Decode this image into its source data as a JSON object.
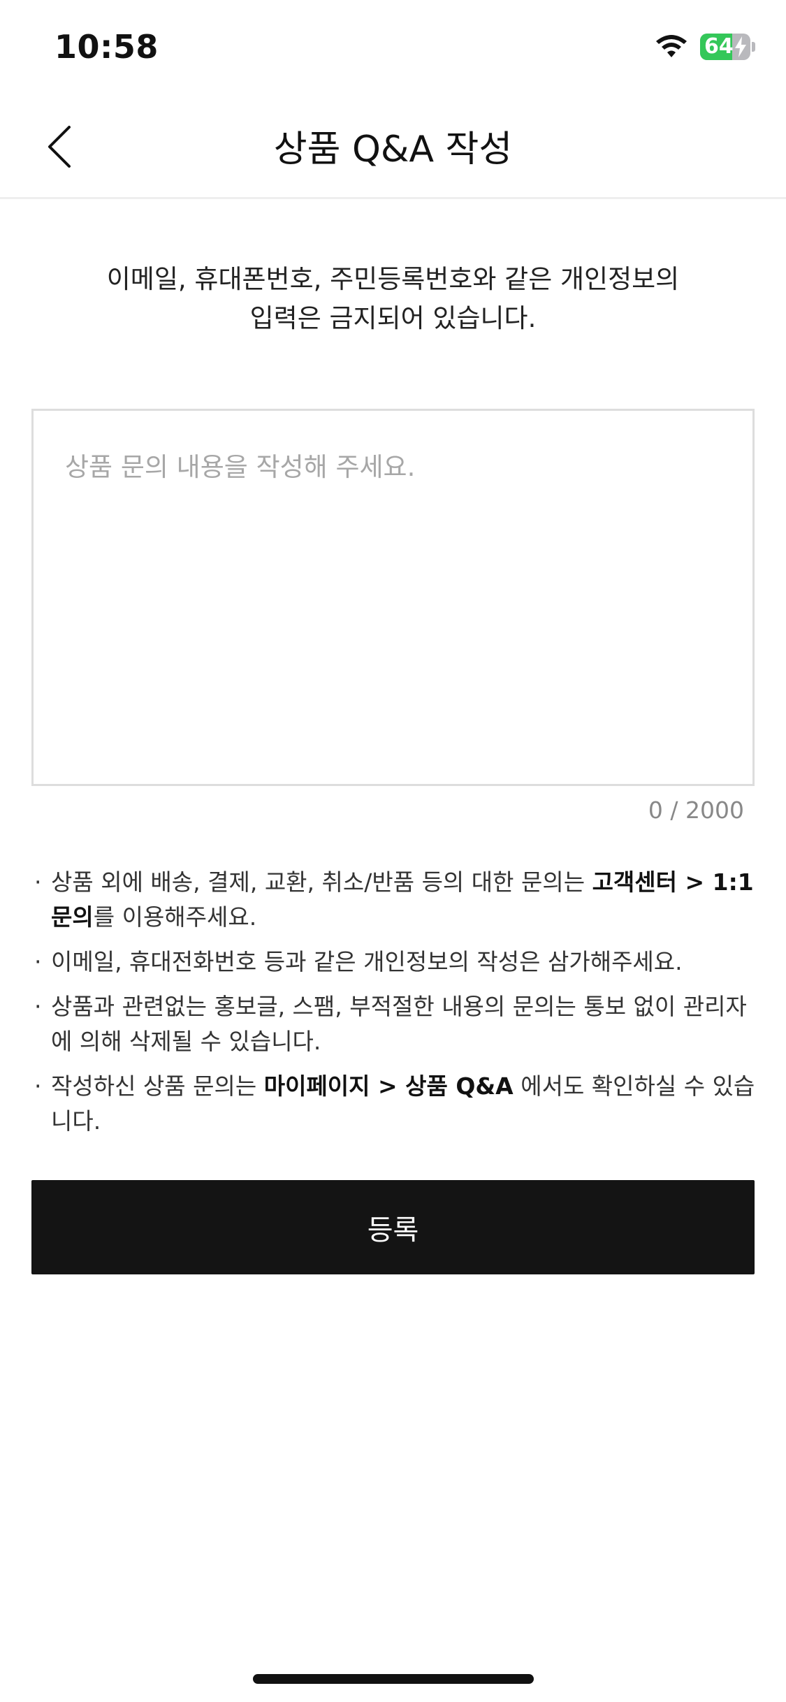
{
  "status_bar": {
    "time": "10:58",
    "battery_level": "64",
    "battery_percent": 64,
    "battery_color": "#34c759"
  },
  "header": {
    "title": "상품 Q&A 작성",
    "back_icon": "chevron-left-icon"
  },
  "notice": {
    "line1": "이메일, 휴대폰번호, 주민등록번호와 같은 개인정보의",
    "line2": "입력은 금지되어 있습니다."
  },
  "form": {
    "input_value": "",
    "input_placeholder": "상품 문의 내용을 작성해 주세요.",
    "char_count": "0 / 2000"
  },
  "guidelines": [
    {
      "before": "상품 외에 배송, 결제, 교환, 취소/반품 등의 대한 문의는 ",
      "bold": "고객센터 > 1:1문의",
      "after": "를 이용해주세요."
    },
    {
      "before": "이메일, 휴대전화번호 등과 같은 개인정보의 작성은 삼가해주세요.",
      "bold": "",
      "after": ""
    },
    {
      "before": "상품과 관련없는 홍보글, 스팸, 부적절한 내용의 문의는 통보 없이 관리자에 의해 삭제될 수 있습니다.",
      "bold": "",
      "after": ""
    },
    {
      "before": "작성하신 상품 문의는 ",
      "bold": "마이페이지 > 상품 Q&A",
      "after": " 에서도 확인하실 수 있습니다."
    }
  ],
  "submit": {
    "label": "등록",
    "color": "#141414"
  }
}
